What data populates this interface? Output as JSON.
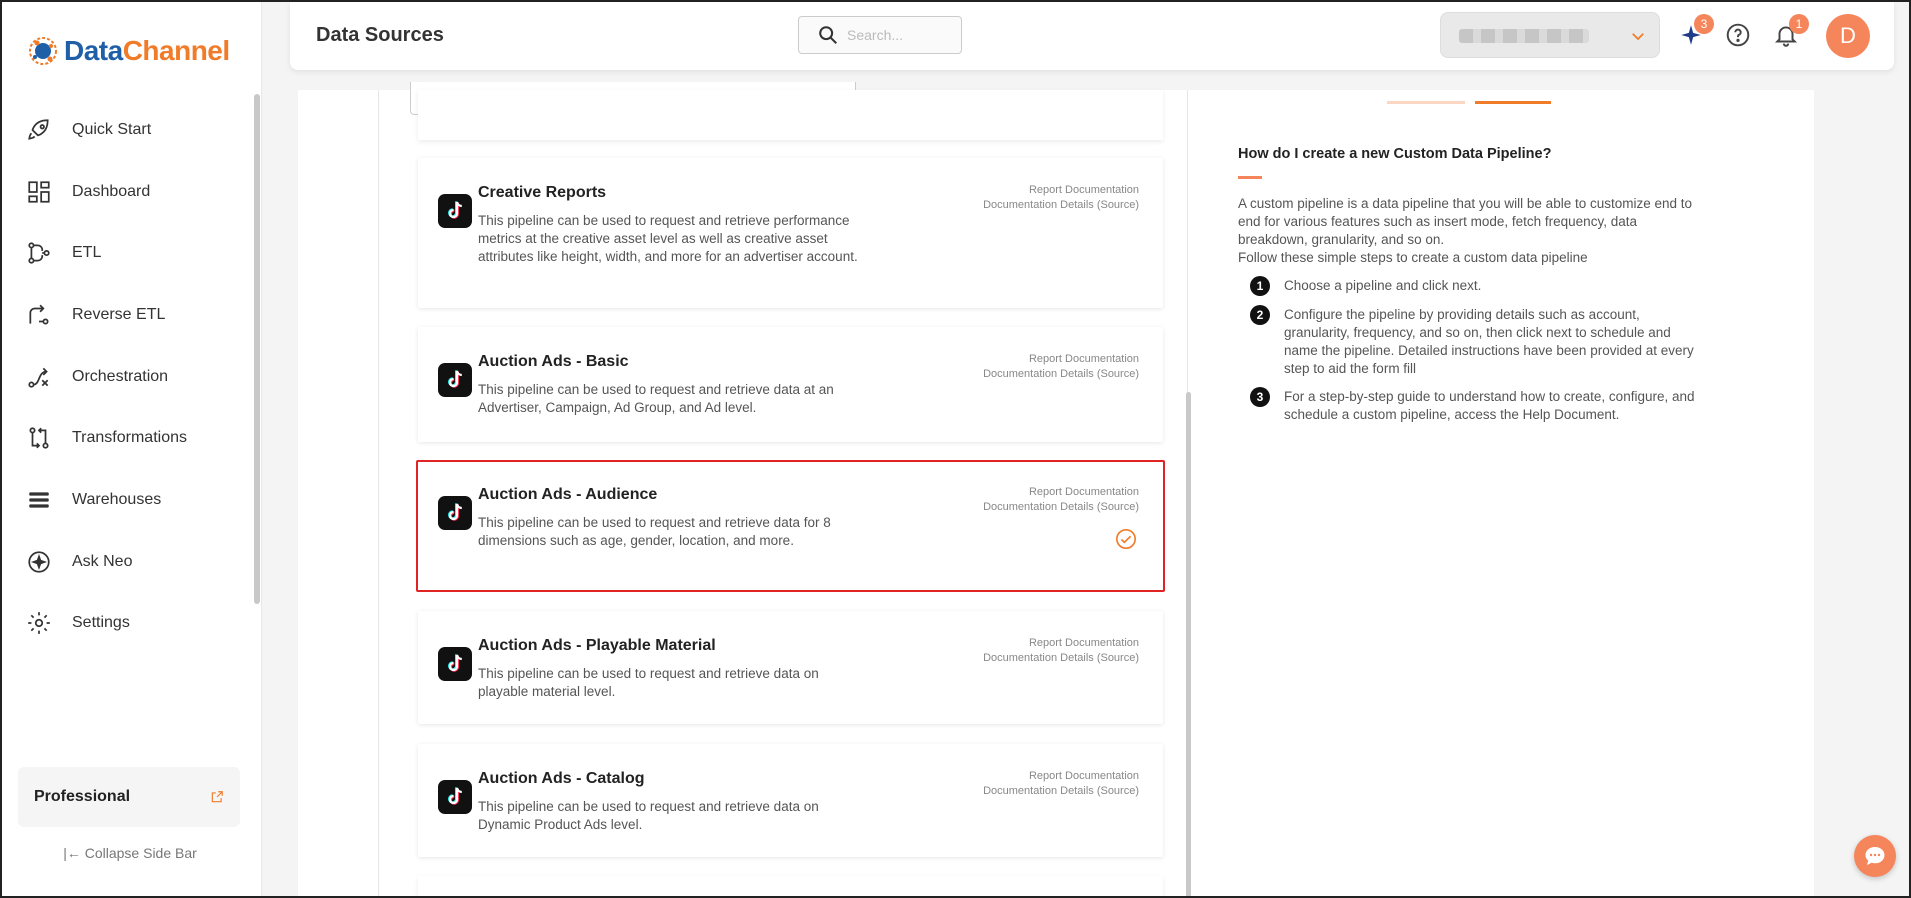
{
  "brand": {
    "name_part1": "Data",
    "name_part2": "Channel",
    "color_primary": "#1f5fa8",
    "color_accent": "#f07c2a"
  },
  "sidebar": {
    "items": [
      {
        "label": "Quick Start",
        "icon": "rocket-icon"
      },
      {
        "label": "Dashboard",
        "icon": "dashboard-icon"
      },
      {
        "label": "ETL",
        "icon": "etl-icon"
      },
      {
        "label": "Reverse ETL",
        "icon": "reverse-etl-icon"
      },
      {
        "label": "Orchestration",
        "icon": "orchestration-icon"
      },
      {
        "label": "Transformations",
        "icon": "transformations-icon"
      },
      {
        "label": "Warehouses",
        "icon": "warehouses-icon"
      },
      {
        "label": "Ask Neo",
        "icon": "ask-neo-icon"
      },
      {
        "label": "Settings",
        "icon": "gear-icon"
      }
    ],
    "plan": "Professional",
    "collapse_label": "Collapse Side Bar"
  },
  "header": {
    "title": "Data Sources",
    "search_placeholder": "Search...",
    "sparkle_badge": "3",
    "notification_badge": "1",
    "avatar_initial": "D"
  },
  "cards": [
    {
      "title": "Creative Reports",
      "description": "This pipeline can be used to request and retrieve performance metrics at the creative asset level as well as creative asset attributes like height, width, and more for an advertiser account.",
      "link1": "Report Documentation",
      "link2": "Documentation Details (Source)",
      "selected": false
    },
    {
      "title": "Auction Ads - Basic",
      "description": "This pipeline can be used to request and retrieve data at an Advertiser, Campaign, Ad Group, and Ad level.",
      "link1": "Report Documentation",
      "link2": "Documentation Details (Source)",
      "selected": false
    },
    {
      "title": "Auction Ads - Audience",
      "description": "This pipeline can be used to request and retrieve data for 8 dimensions such as age, gender, location, and more.",
      "link1": "Report Documentation",
      "link2": "Documentation Details (Source)",
      "selected": true
    },
    {
      "title": "Auction Ads - Playable Material",
      "description": "This pipeline can be used to request and retrieve data on playable material level.",
      "link1": "Report Documentation",
      "link2": "Documentation Details (Source)",
      "selected": false
    },
    {
      "title": "Auction Ads - Catalog",
      "description": "This pipeline can be used to request and retrieve data on Dynamic Product Ads level.",
      "link1": "Report Documentation",
      "link2": "Documentation Details (Source)",
      "selected": false
    }
  ],
  "help": {
    "title": "How do I create a new Custom Data Pipeline?",
    "intro": "A custom pipeline is a data pipeline that you will be able to customize end to end for various features such as insert mode, fetch frequency, data breakdown, granularity, and so on.",
    "follow": "Follow these simple steps to create a custom data pipeline",
    "steps": [
      {
        "num": "1",
        "text": "Choose a pipeline and click next."
      },
      {
        "num": "2",
        "text": "Configure the pipeline by providing details such as account, granularity, frequency, and so on, then click next to schedule and name the pipeline. Detailed instructions have been provided at every step to aid the form fill"
      },
      {
        "num": "3",
        "text": "For a step-by-step guide to understand how to create, configure, and schedule a custom pipeline, access the Help Document."
      }
    ]
  }
}
